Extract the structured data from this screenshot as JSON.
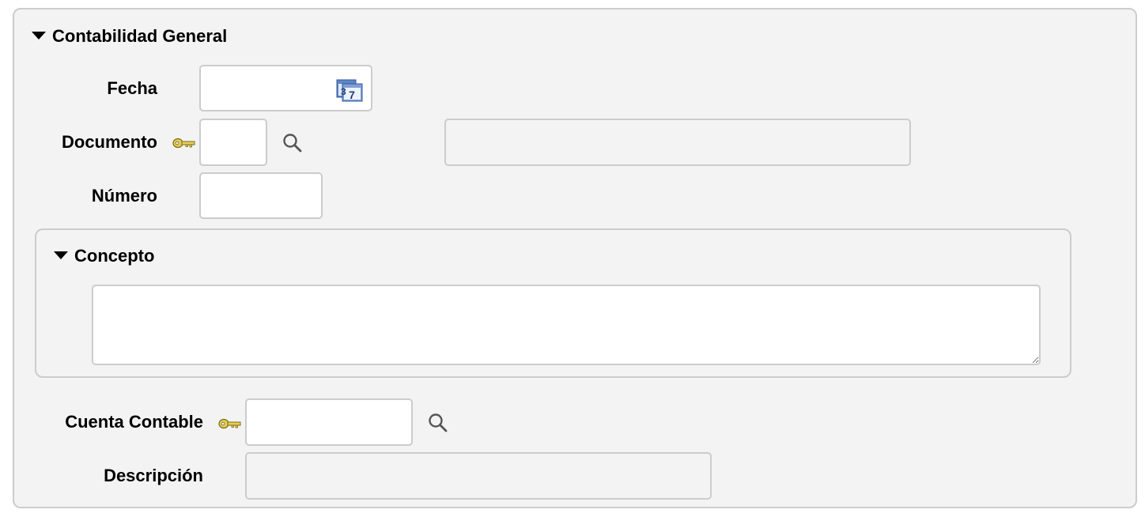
{
  "section": {
    "title": "Contabilidad General",
    "fields": {
      "fecha": {
        "label": "Fecha",
        "value": "",
        "icon": "calendar-icon"
      },
      "documento": {
        "label": "Documento",
        "value": "",
        "description": "",
        "key_icon": "key-icon",
        "search_icon": "search-icon"
      },
      "numero": {
        "label": "Número",
        "value": ""
      }
    },
    "concepto": {
      "title": "Concepto",
      "value": ""
    },
    "cuenta_contable": {
      "label": "Cuenta Contable",
      "value": "",
      "key_icon": "key-icon",
      "search_icon": "search-icon"
    },
    "descripcion": {
      "label": "Descripción",
      "value": ""
    }
  },
  "colors": {
    "group_background": "#f3f3f3",
    "group_border": "#cccccc",
    "input_background": "#ffffff",
    "readonly_background": "#f3f3f3",
    "key_icon": "#c9b23a"
  }
}
